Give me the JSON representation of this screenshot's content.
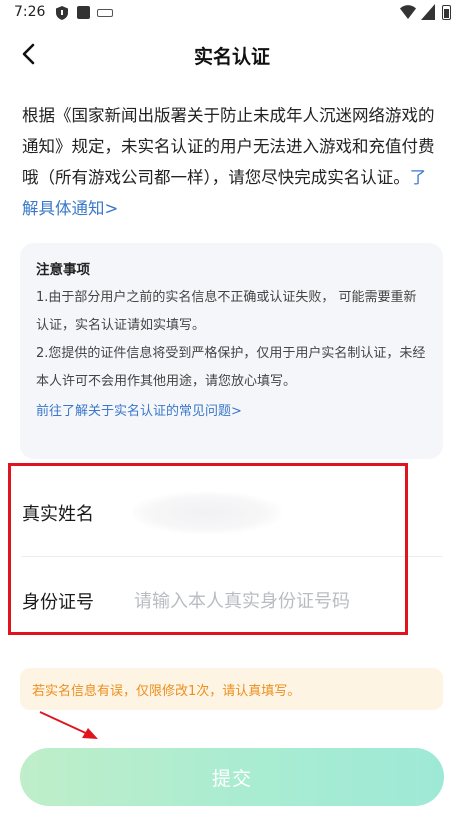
{
  "status_bar": {
    "time": "7:26",
    "icons": [
      "shield-icon",
      "square-icon",
      "keyboard-icon",
      "wifi-icon",
      "signal-icon",
      "battery-icon"
    ]
  },
  "header": {
    "title": "实名认证",
    "back_icon": "chevron-left-icon"
  },
  "intro": {
    "text": "根据《国家新闻出版署关于防止未成年人沉迷网络游戏的通知》规定，未实名认证的用户无法进入游戏和充值付费哦（所有游戏公司都一样），请您尽快完成实名认证。",
    "link": "了解具体通知>"
  },
  "notice": {
    "title": "注意事项",
    "items": [
      "1.由于部分用户之前的实名信息不正确或认证失败， 可能需要重新认证，实名认证请如实填写。",
      "2.您提供的证件信息将受到严格保护，仅用于用户实名制认证，未经本人许可不会用作其他用途，请您放心填写。"
    ],
    "link": "前往了解关于实名认证的常见问题>"
  },
  "form": {
    "name_label": "真实姓名",
    "name_value": "",
    "id_label": "身份证号",
    "id_placeholder": "请输入本人真实身份证号码",
    "id_value": ""
  },
  "warning": "若实名信息有误，仅限修改1次，请认真填写。",
  "submit_label": "提交",
  "colors": {
    "accent_link": "#3a78c9",
    "warning_text": "#ec8f1d",
    "warning_bg": "#fdf4e3",
    "annotation_red": "#e0141e",
    "submit_gradient_start": "#bfeec9",
    "submit_gradient_end": "#9ee9d6"
  }
}
